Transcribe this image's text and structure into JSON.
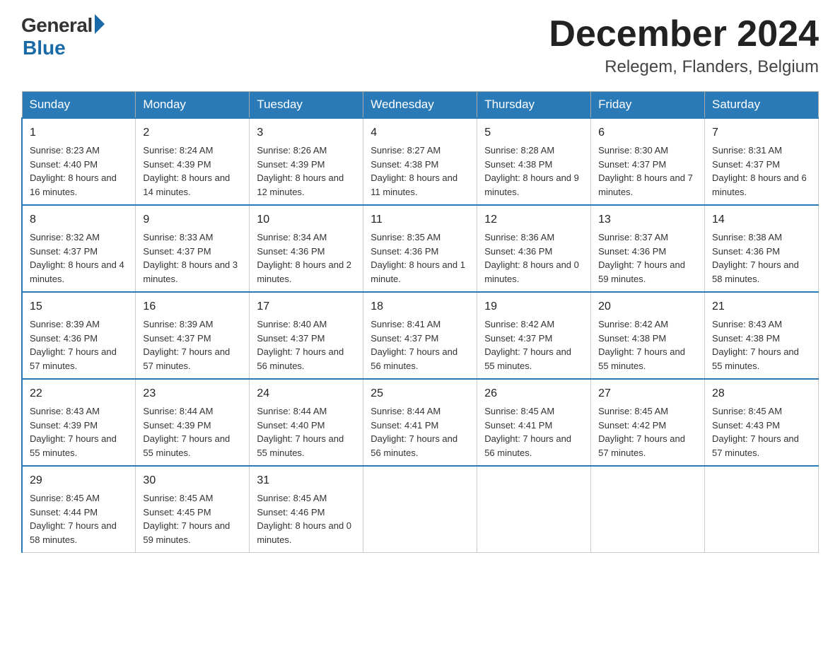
{
  "header": {
    "logo_general": "General",
    "logo_blue": "Blue",
    "month_year": "December 2024",
    "location": "Relegem, Flanders, Belgium"
  },
  "days_of_week": [
    "Sunday",
    "Monday",
    "Tuesday",
    "Wednesday",
    "Thursday",
    "Friday",
    "Saturday"
  ],
  "weeks": [
    [
      {
        "day": "1",
        "sunrise": "8:23 AM",
        "sunset": "4:40 PM",
        "daylight": "8 hours and 16 minutes."
      },
      {
        "day": "2",
        "sunrise": "8:24 AM",
        "sunset": "4:39 PM",
        "daylight": "8 hours and 14 minutes."
      },
      {
        "day": "3",
        "sunrise": "8:26 AM",
        "sunset": "4:39 PM",
        "daylight": "8 hours and 12 minutes."
      },
      {
        "day": "4",
        "sunrise": "8:27 AM",
        "sunset": "4:38 PM",
        "daylight": "8 hours and 11 minutes."
      },
      {
        "day": "5",
        "sunrise": "8:28 AM",
        "sunset": "4:38 PM",
        "daylight": "8 hours and 9 minutes."
      },
      {
        "day": "6",
        "sunrise": "8:30 AM",
        "sunset": "4:37 PM",
        "daylight": "8 hours and 7 minutes."
      },
      {
        "day": "7",
        "sunrise": "8:31 AM",
        "sunset": "4:37 PM",
        "daylight": "8 hours and 6 minutes."
      }
    ],
    [
      {
        "day": "8",
        "sunrise": "8:32 AM",
        "sunset": "4:37 PM",
        "daylight": "8 hours and 4 minutes."
      },
      {
        "day": "9",
        "sunrise": "8:33 AM",
        "sunset": "4:37 PM",
        "daylight": "8 hours and 3 minutes."
      },
      {
        "day": "10",
        "sunrise": "8:34 AM",
        "sunset": "4:36 PM",
        "daylight": "8 hours and 2 minutes."
      },
      {
        "day": "11",
        "sunrise": "8:35 AM",
        "sunset": "4:36 PM",
        "daylight": "8 hours and 1 minute."
      },
      {
        "day": "12",
        "sunrise": "8:36 AM",
        "sunset": "4:36 PM",
        "daylight": "8 hours and 0 minutes."
      },
      {
        "day": "13",
        "sunrise": "8:37 AM",
        "sunset": "4:36 PM",
        "daylight": "7 hours and 59 minutes."
      },
      {
        "day": "14",
        "sunrise": "8:38 AM",
        "sunset": "4:36 PM",
        "daylight": "7 hours and 58 minutes."
      }
    ],
    [
      {
        "day": "15",
        "sunrise": "8:39 AM",
        "sunset": "4:36 PM",
        "daylight": "7 hours and 57 minutes."
      },
      {
        "day": "16",
        "sunrise": "8:39 AM",
        "sunset": "4:37 PM",
        "daylight": "7 hours and 57 minutes."
      },
      {
        "day": "17",
        "sunrise": "8:40 AM",
        "sunset": "4:37 PM",
        "daylight": "7 hours and 56 minutes."
      },
      {
        "day": "18",
        "sunrise": "8:41 AM",
        "sunset": "4:37 PM",
        "daylight": "7 hours and 56 minutes."
      },
      {
        "day": "19",
        "sunrise": "8:42 AM",
        "sunset": "4:37 PM",
        "daylight": "7 hours and 55 minutes."
      },
      {
        "day": "20",
        "sunrise": "8:42 AM",
        "sunset": "4:38 PM",
        "daylight": "7 hours and 55 minutes."
      },
      {
        "day": "21",
        "sunrise": "8:43 AM",
        "sunset": "4:38 PM",
        "daylight": "7 hours and 55 minutes."
      }
    ],
    [
      {
        "day": "22",
        "sunrise": "8:43 AM",
        "sunset": "4:39 PM",
        "daylight": "7 hours and 55 minutes."
      },
      {
        "day": "23",
        "sunrise": "8:44 AM",
        "sunset": "4:39 PM",
        "daylight": "7 hours and 55 minutes."
      },
      {
        "day": "24",
        "sunrise": "8:44 AM",
        "sunset": "4:40 PM",
        "daylight": "7 hours and 55 minutes."
      },
      {
        "day": "25",
        "sunrise": "8:44 AM",
        "sunset": "4:41 PM",
        "daylight": "7 hours and 56 minutes."
      },
      {
        "day": "26",
        "sunrise": "8:45 AM",
        "sunset": "4:41 PM",
        "daylight": "7 hours and 56 minutes."
      },
      {
        "day": "27",
        "sunrise": "8:45 AM",
        "sunset": "4:42 PM",
        "daylight": "7 hours and 57 minutes."
      },
      {
        "day": "28",
        "sunrise": "8:45 AM",
        "sunset": "4:43 PM",
        "daylight": "7 hours and 57 minutes."
      }
    ],
    [
      {
        "day": "29",
        "sunrise": "8:45 AM",
        "sunset": "4:44 PM",
        "daylight": "7 hours and 58 minutes."
      },
      {
        "day": "30",
        "sunrise": "8:45 AM",
        "sunset": "4:45 PM",
        "daylight": "7 hours and 59 minutes."
      },
      {
        "day": "31",
        "sunrise": "8:45 AM",
        "sunset": "4:46 PM",
        "daylight": "8 hours and 0 minutes."
      },
      null,
      null,
      null,
      null
    ]
  ],
  "labels": {
    "sunrise": "Sunrise:",
    "sunset": "Sunset:",
    "daylight": "Daylight:"
  }
}
